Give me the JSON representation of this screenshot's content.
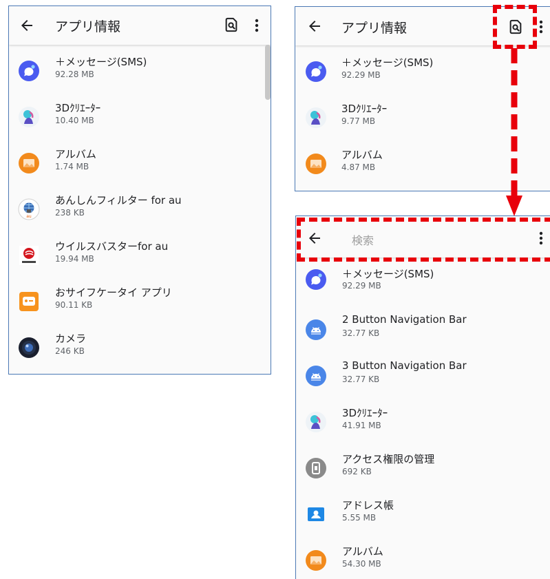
{
  "screen_before": {
    "title": "アプリ情報",
    "apps": [
      {
        "name": "＋メッセージ(SMS)",
        "size": "92.28 MB",
        "icon": "messages-icon"
      },
      {
        "name": "3Dｸﾘｴｰﾀｰ",
        "size": "10.40 MB",
        "icon": "3d-creator-icon"
      },
      {
        "name": "アルバム",
        "size": "1.74 MB",
        "icon": "album-icon"
      },
      {
        "name": "あんしんフィルター for au",
        "size": "238 KB",
        "icon": "anshin-filter-icon"
      },
      {
        "name": "ウイルスバスターfor au",
        "size": "19.94 MB",
        "icon": "virus-buster-icon"
      },
      {
        "name": "おサイフケータイ アプリ",
        "size": "90.11 KB",
        "icon": "osaifu-keitai-icon"
      },
      {
        "name": "カメラ",
        "size": "246 KB",
        "icon": "camera-icon"
      }
    ]
  },
  "screen_top_right": {
    "title": "アプリ情報",
    "apps": [
      {
        "name": "＋メッセージ(SMS)",
        "size": "92.29 MB",
        "icon": "messages-icon"
      },
      {
        "name": "3Dｸﾘｴｰﾀｰ",
        "size": "9.77 MB",
        "icon": "3d-creator-icon"
      },
      {
        "name": "アルバム",
        "size": "4.87 MB",
        "icon": "album-icon"
      }
    ]
  },
  "screen_search": {
    "search_placeholder": "検索",
    "apps": [
      {
        "name": "＋メッセージ(SMS)",
        "size": "92.29 MB",
        "icon": "messages-icon"
      },
      {
        "name": "2 Button Navigation Bar",
        "size": "32.77 KB",
        "icon": "android-icon"
      },
      {
        "name": "3 Button Navigation Bar",
        "size": "32.77 KB",
        "icon": "android-icon"
      },
      {
        "name": "3Dｸﾘｴｰﾀｰ",
        "size": "41.91 MB",
        "icon": "3d-creator-icon"
      },
      {
        "name": "アクセス権限の管理",
        "size": "692 KB",
        "icon": "permission-manager-icon"
      },
      {
        "name": "アドレス帳",
        "size": "5.55 MB",
        "icon": "contacts-icon"
      },
      {
        "name": "アルバム",
        "size": "54.30 MB",
        "icon": "album-icon"
      }
    ]
  },
  "colors": {
    "annotation": "#e8000b",
    "frame_border": "#4a78b4",
    "messages": "#4a5bf0",
    "album": "#f28a1c",
    "android": "#4a86e8",
    "contacts": "#1e88e5"
  }
}
